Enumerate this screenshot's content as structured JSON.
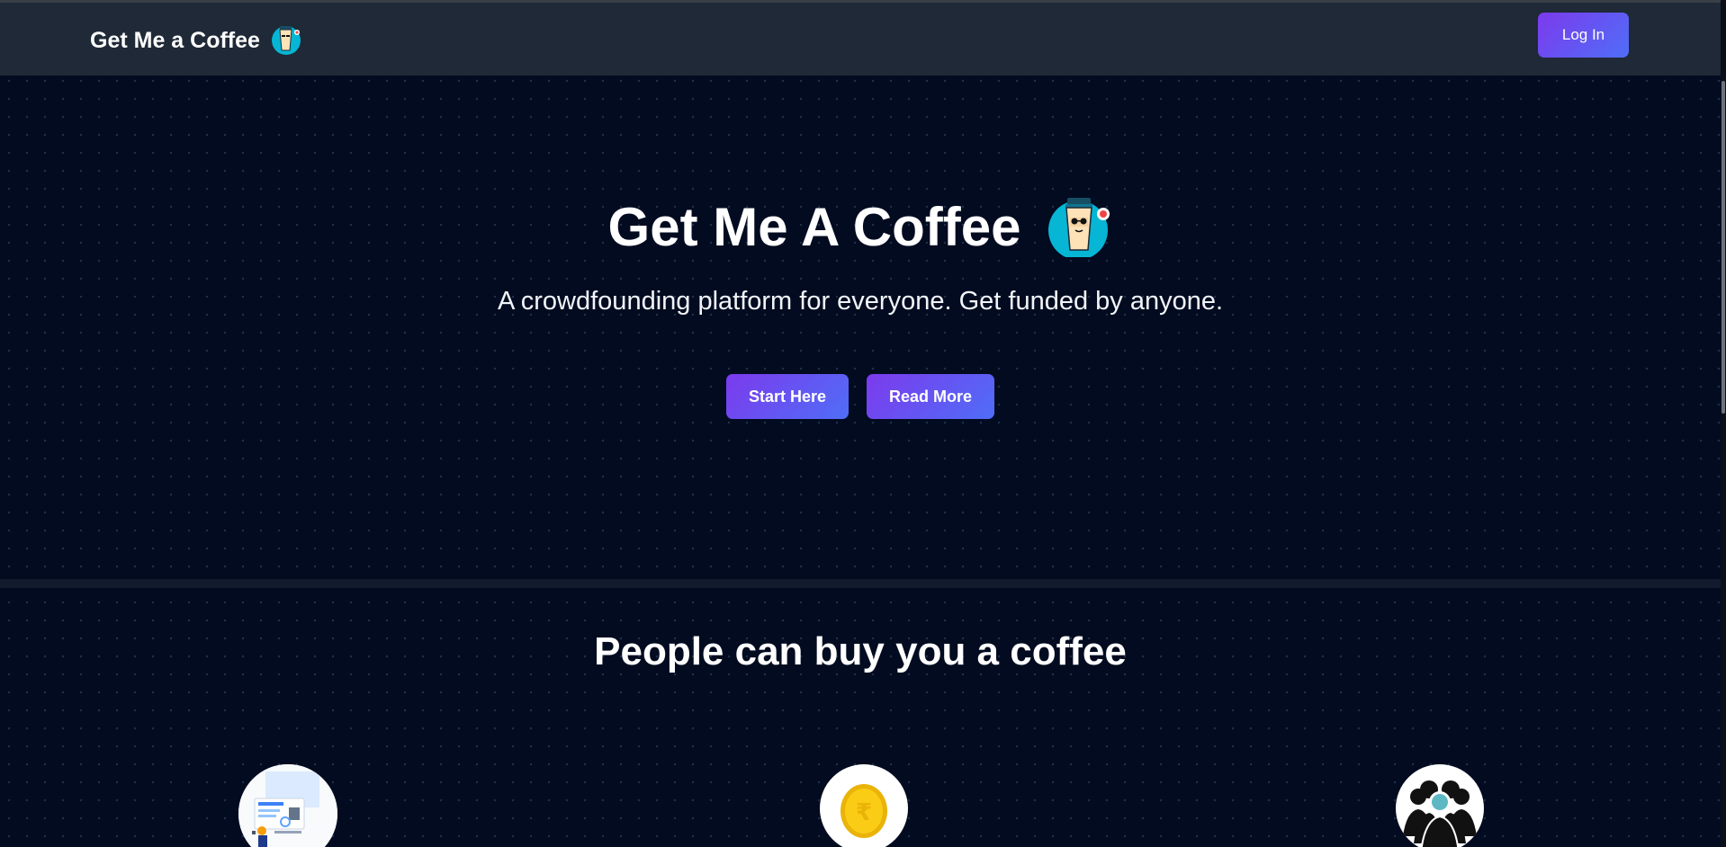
{
  "navbar": {
    "brand": "Get Me a Coffee",
    "brand_icon": "coffee-cup-icon",
    "login_label": "Log In"
  },
  "hero": {
    "title": "Get Me A Coffee",
    "title_icon": "coffee-cup-icon",
    "subtitle": "A crowdfounding platform for everyone. Get funded by anyone.",
    "start_label": "Start Here",
    "read_more_label": "Read More"
  },
  "section2": {
    "title": "People can buy you a coffee",
    "features": [
      {
        "icon": "person-at-computer-icon"
      },
      {
        "icon": "rupee-coin-icon"
      },
      {
        "icon": "group-people-icon"
      }
    ]
  },
  "colors": {
    "background": "#020b20",
    "navbar": "#1f2937",
    "button_gradient_start": "#7c3aed",
    "button_gradient_end": "#4f6ef7",
    "coffee_circle": "#06b6d4"
  }
}
